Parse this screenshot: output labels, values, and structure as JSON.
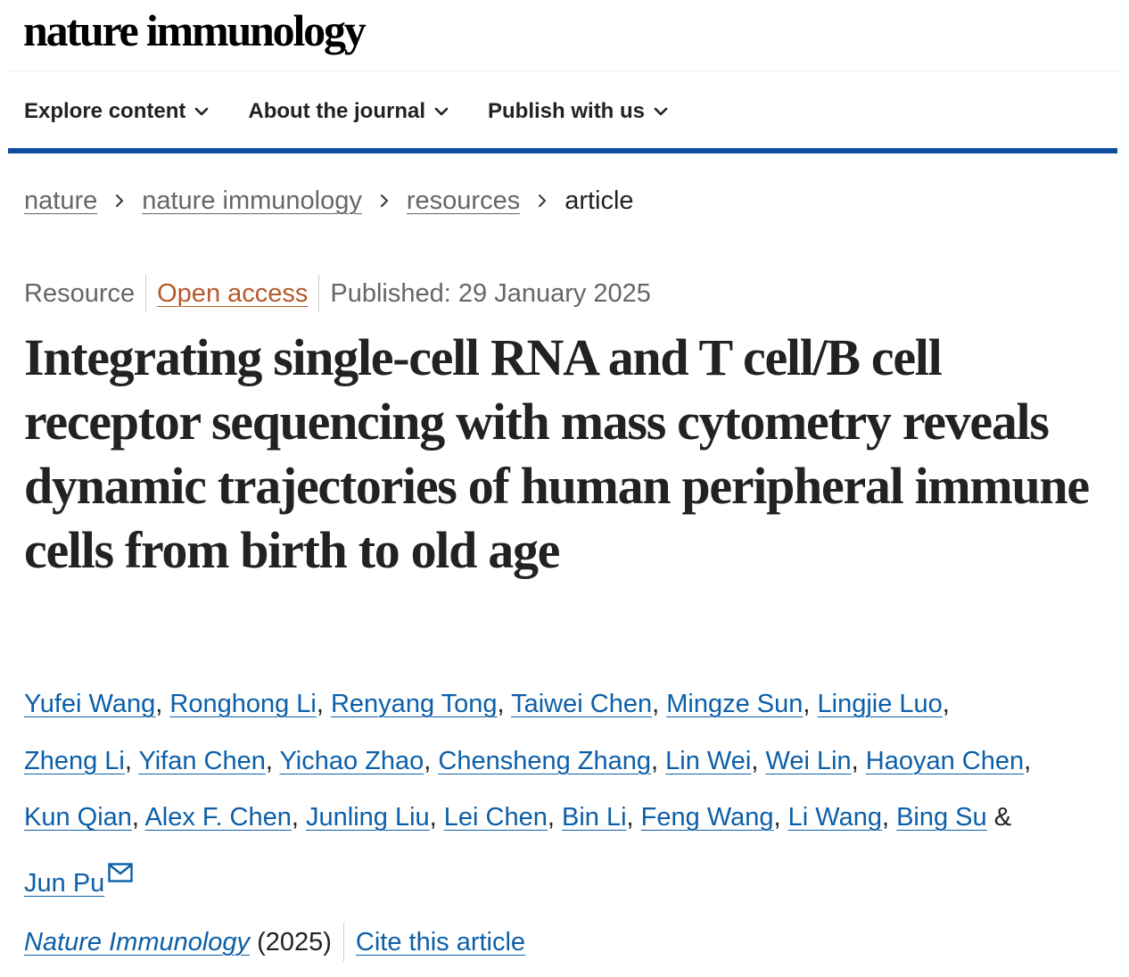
{
  "header": {
    "logo_text": "nature immunology"
  },
  "nav": {
    "items": [
      {
        "label": "Explore content",
        "icon": "chevron-down-icon"
      },
      {
        "label": "About the journal",
        "icon": "chevron-down-icon"
      },
      {
        "label": "Publish with us",
        "icon": "chevron-down-icon"
      }
    ]
  },
  "breadcrumb": {
    "items": [
      "nature",
      "nature immunology",
      "resources"
    ],
    "current": "article",
    "separator_icon": "chevron-right-icon"
  },
  "article": {
    "type": "Resource",
    "access": "Open access",
    "published": "Published: 29 January 2025",
    "title": "Integrating single-cell RNA and T  cell/B  cell receptor sequencing with mass cytometry reveals dynamic trajectories of human peripheral immune cells from birth to old age",
    "authors": [
      "Yufei Wang",
      "Ronghong Li",
      "Renyang Tong",
      "Taiwei Chen",
      "Mingze Sun",
      "Lingjie Luo",
      "Zheng Li",
      "Yifan Chen",
      "Yichao Zhao",
      "Chensheng Zhang",
      "Lin Wei",
      "Wei Lin",
      "Haoyan Chen",
      "Kun Qian",
      "Alex F. Chen",
      "Junling Liu",
      "Lei Chen",
      "Bin Li",
      "Feng Wang",
      "Li Wang",
      "Bing Su",
      "Jun Pu"
    ],
    "author_separator": ",",
    "author_last_separator": "&",
    "corresponding_icon": "mail-icon",
    "journal": "Nature Immunology",
    "year": "(2025)",
    "cite_label": "Cite this article"
  },
  "colors": {
    "nav_rule": "#0f4b9f",
    "link": "#0c5fa8",
    "open_access": "#b55a2c",
    "text": "#222222",
    "muted": "#666666"
  }
}
